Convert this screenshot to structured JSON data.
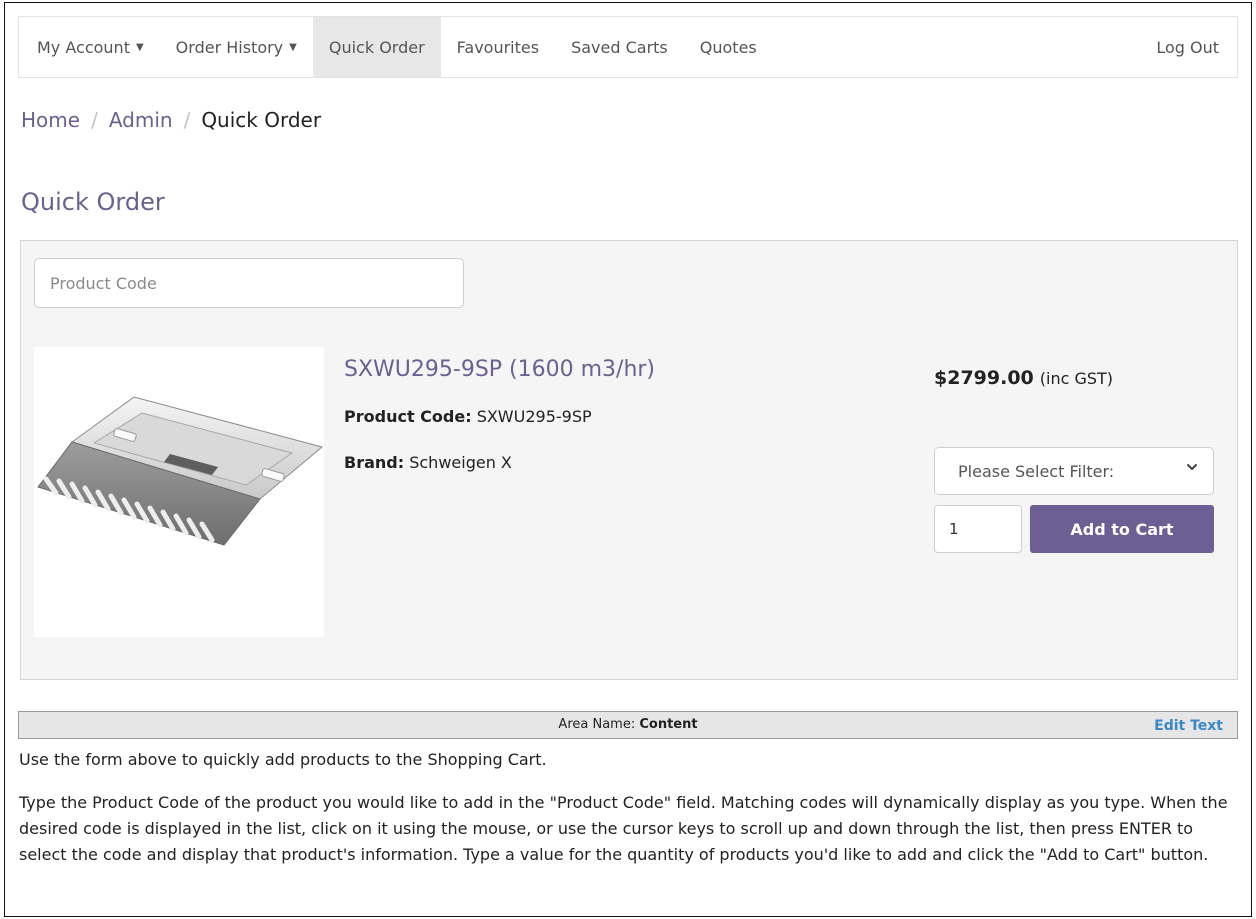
{
  "nav": {
    "items": [
      {
        "label": "My Account",
        "caret": true
      },
      {
        "label": "Order History",
        "caret": true
      },
      {
        "label": "Quick Order",
        "caret": false
      },
      {
        "label": "Favourites",
        "caret": false
      },
      {
        "label": "Saved Carts",
        "caret": false
      },
      {
        "label": "Quotes",
        "caret": false
      }
    ],
    "logout": "Log Out"
  },
  "breadcrumb": {
    "home": "Home",
    "admin": "Admin",
    "current": "Quick Order",
    "separator": "/"
  },
  "page_title": "Quick Order",
  "search": {
    "placeholder": "Product Code"
  },
  "product": {
    "name": "SXWU295-9SP (1600 m3/hr)",
    "code_label": "Product Code:",
    "code": "SXWU295-9SP",
    "brand_label": "Brand:",
    "brand": "Schweigen X",
    "price": "$2799.00",
    "price_note": "(inc GST)",
    "filter_selected": "Please Select Filter:",
    "quantity": "1",
    "add_to_cart": "Add to Cart"
  },
  "area_bar": {
    "label": "Area Name:",
    "name": "Content",
    "edit": "Edit Text"
  },
  "content": {
    "p1": "Use the form above to quickly add products to the Shopping Cart.",
    "p2": "Type the Product Code of the product you would like to add in the \"Product Code\" field. Matching codes will dynamically display as you type. When the desired code is displayed in the list, click on it using the mouse, or use the cursor keys to scroll up and down through the list, then press ENTER to select the code and display that product's information. Type a value for the quantity of products you'd like to add and click the \"Add to Cart\" button."
  },
  "colors": {
    "brand_purple": "#6b5f93",
    "edit_link_blue": "#3a88c8"
  }
}
